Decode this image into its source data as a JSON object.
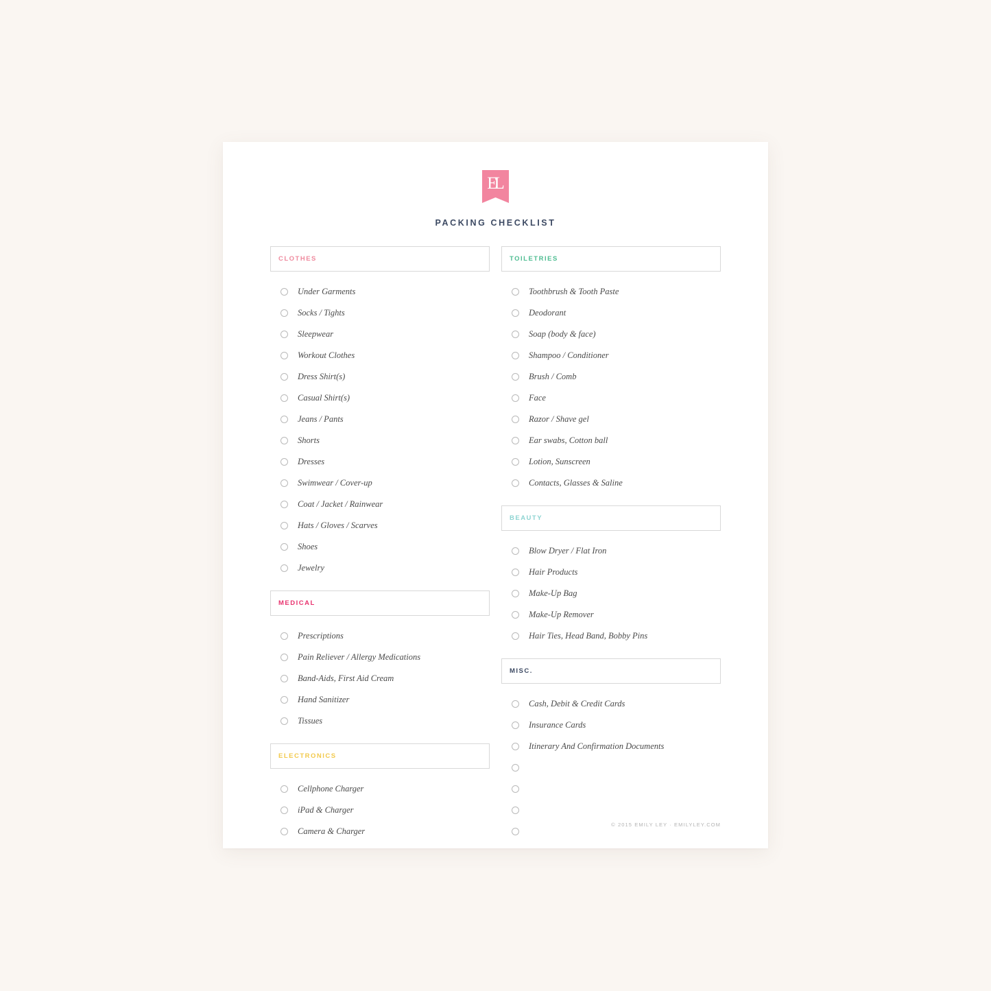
{
  "background_color": "#faf6f2",
  "page_color": "#ffffff",
  "masthead": {
    "logo_icon": "emily-ley-ribbon-logo",
    "logo_monogram": "EL",
    "logo_color": "#f2859f",
    "title": "PACKING CHECKLIST",
    "title_color": "#3d4a63"
  },
  "left_column": {
    "sections": [
      {
        "key": "clothes",
        "title": "CLOTHES",
        "color": "#ef8a9e",
        "items": [
          "Under Garments",
          "Socks / Tights",
          "Sleepwear",
          "Workout Clothes",
          "Dress Shirt(s)",
          "Casual Shirt(s)",
          "Jeans / Pants",
          "Shorts",
          "Dresses",
          "Swimwear / Cover-up",
          "Coat / Jacket / Rainwear",
          "Hats / Gloves / Scarves",
          "Shoes",
          "Jewelry"
        ]
      },
      {
        "key": "medical",
        "title": "MEDICAL",
        "color": "#e8336f",
        "items": [
          "Prescriptions",
          "Pain Reliever / Allergy Medications",
          "Band-Aids, First Aid Cream",
          "Hand Sanitizer",
          "Tissues"
        ]
      },
      {
        "key": "electronics",
        "title": "ELECTRONICS",
        "color": "#f2c94c",
        "items": [
          "Cellphone Charger",
          "iPad & Charger",
          "Camera & Charger"
        ]
      }
    ]
  },
  "right_column": {
    "sections": [
      {
        "key": "toiletries",
        "title": "TOILETRIES",
        "color": "#4fbd92",
        "items": [
          "Toothbrush & Tooth Paste",
          "Deodorant",
          "Soap (body & face)",
          "Shampoo / Conditioner",
          "Brush / Comb",
          "Face",
          "Razor / Shave gel",
          "Ear swabs, Cotton ball",
          "Lotion, Sunscreen",
          "Contacts, Glasses & Saline"
        ]
      },
      {
        "key": "beauty",
        "title": "BEAUTY",
        "color": "#8ed4d2",
        "items": [
          "Blow Dryer / Flat Iron",
          "Hair Products",
          "Make-Up Bag",
          "Make-Up Remover",
          "Hair Ties, Head Band, Bobby Pins"
        ]
      },
      {
        "key": "misc",
        "title": "MISC.",
        "color": "#3d4a63",
        "items": [
          "Cash, Debit & Credit Cards",
          "Insurance Cards",
          "Itinerary And Confirmation Documents",
          "",
          "",
          "",
          ""
        ]
      }
    ]
  },
  "footer": {
    "copyright": "© 2015 EMILY LEY · EMILYLEY.COM"
  }
}
